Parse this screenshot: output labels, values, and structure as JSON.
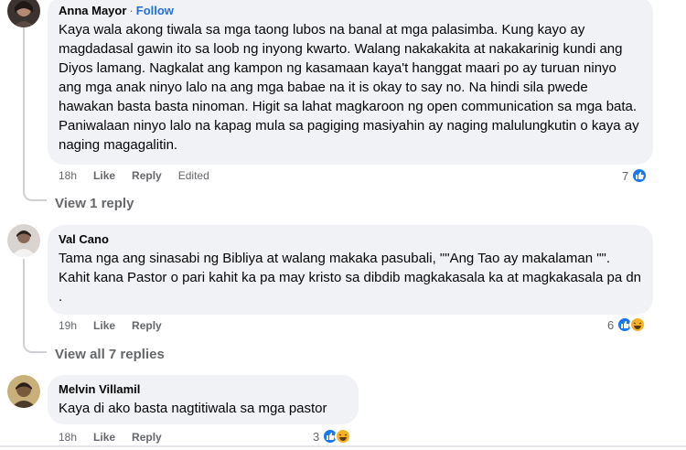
{
  "comments": [
    {
      "author": "Anna Mayor",
      "follow_separator": "·",
      "follow_label": "Follow",
      "text": "Kaya wala akong tiwala sa mga taong lubos na banal at mga palasimba. Kung kayo ay magdadasal gawin ito sa loob ng inyong kwarto. Walang nakakakita at nakakarinig kundi ang Diyos lamang. Nagkalat ang kampon ng kasamaan kaya't hanggat maari po ay turuan ninyo ang mga anak ninyo lalo na ang mga babae na it is okay to say no. Na hindi sila pwede hawakan basta basta ninoman. Higit sa lahat magkaroon ng open communication sa mga bata. Paniwalaan ninyo lalo na kapag mula sa pagiging masiyahin ay naging malulungkutin o kaya ay naging magagalitin.",
      "time": "18h",
      "like_label": "Like",
      "reply_label": "Reply",
      "edited_label": "Edited",
      "reaction_count": "7",
      "reactions": [
        "like-icon"
      ],
      "view_replies": "View 1 reply"
    },
    {
      "author": "Val Cano",
      "text": "Tama nga ang sinasabi ng Bibliya at walang makaka pasubali, \"\"Ang Tao ay makalaman \"\". Kahit kana Pastor o pari kahit ka pa may kristo sa dibdib magkakasala ka at magkakasala pa dn .",
      "time": "19h",
      "like_label": "Like",
      "reply_label": "Reply",
      "reaction_count": "6",
      "reactions": [
        "like-icon",
        "haha-icon"
      ],
      "view_replies": "View all 7 replies"
    },
    {
      "author": "Melvin Villamil",
      "text": "Kaya di ako basta nagtitiwala sa mga pastor",
      "time": "18h",
      "like_label": "Like",
      "reply_label": "Reply",
      "reaction_count": "3",
      "reactions": [
        "like-icon",
        "haha-icon"
      ]
    }
  ],
  "colors": {
    "bubble_bg": "#f0f2f5",
    "secondary_text": "#65676b",
    "follow_link": "#216fdb",
    "like_blue": "#1877f2",
    "haha_yellow": "#f7b125"
  }
}
